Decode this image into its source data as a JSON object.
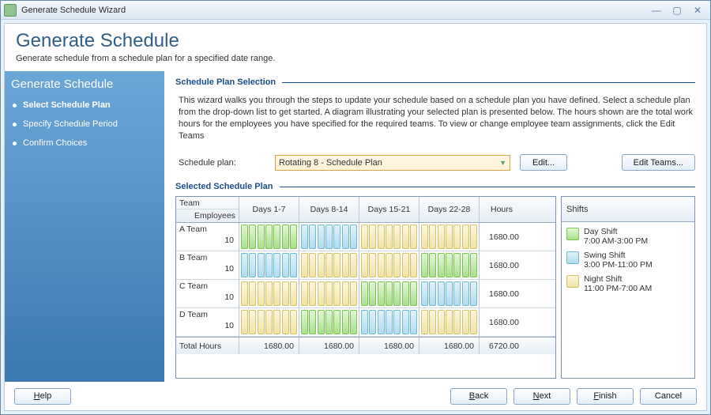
{
  "titlebar": {
    "title": "Generate Schedule Wizard"
  },
  "header": {
    "title": "Generate Schedule",
    "subtitle": "Generate schedule from a schedule plan for a specified date range."
  },
  "sidebar": {
    "title": "Generate Schedule",
    "steps": [
      "Select Schedule Plan",
      "Specify Schedule Period",
      "Confirm Choices"
    ]
  },
  "section1": {
    "title": "Schedule Plan Selection",
    "intro": "This wizard walks you through the steps to update your schedule based on a schedule plan you have defined.  Select a schedule plan from the drop-down list to get started.  A diagram illustrating your selected plan is presented below. The hours shown are the total work hours for the employees you have specified for the required teams. To view or change employee team assignments, click the Edit Teams",
    "plan_label": "Schedule plan:",
    "plan_value": "Rotating 8 - Schedule Plan",
    "edit_label": "Edit...",
    "edit_teams_label": "Edit Teams..."
  },
  "section2": {
    "title": "Selected Schedule Plan",
    "team_header": "Team",
    "employees_header": "Employees",
    "hours_header": "Hours",
    "shifts_header": "Shifts",
    "total_label": "Total Hours",
    "week_headers": [
      "Days 1-7",
      "Days 8-14",
      "Days 15-21",
      "Days 22-28"
    ],
    "teams": [
      {
        "name": "A Team",
        "employees": 10,
        "hours": "1680.00",
        "pattern": [
          "day",
          "swing",
          "night",
          "night"
        ]
      },
      {
        "name": "B Team",
        "employees": 10,
        "hours": "1680.00",
        "pattern": [
          "swing",
          "night",
          "night",
          "day"
        ]
      },
      {
        "name": "C Team",
        "employees": 10,
        "hours": "1680.00",
        "pattern": [
          "night",
          "night",
          "day",
          "swing"
        ]
      },
      {
        "name": "D Team",
        "employees": 10,
        "hours": "1680.00",
        "pattern": [
          "night",
          "day",
          "swing",
          "night"
        ]
      }
    ],
    "week_totals": [
      "1680.00",
      "1680.00",
      "1680.00",
      "1680.00"
    ],
    "grand_total": "6720.00",
    "legend": [
      {
        "name": "Day Shift",
        "time": "7:00 AM-3:00 PM",
        "cls": "day"
      },
      {
        "name": "Swing Shift",
        "time": "3:00 PM-11:00 PM",
        "cls": "swing"
      },
      {
        "name": "Night Shift",
        "time": "11:00 PM-7:00 AM",
        "cls": "night"
      }
    ]
  },
  "footer": {
    "help": "Help",
    "back": "Back",
    "next": "Next",
    "finish": "Finish",
    "cancel": "Cancel"
  }
}
